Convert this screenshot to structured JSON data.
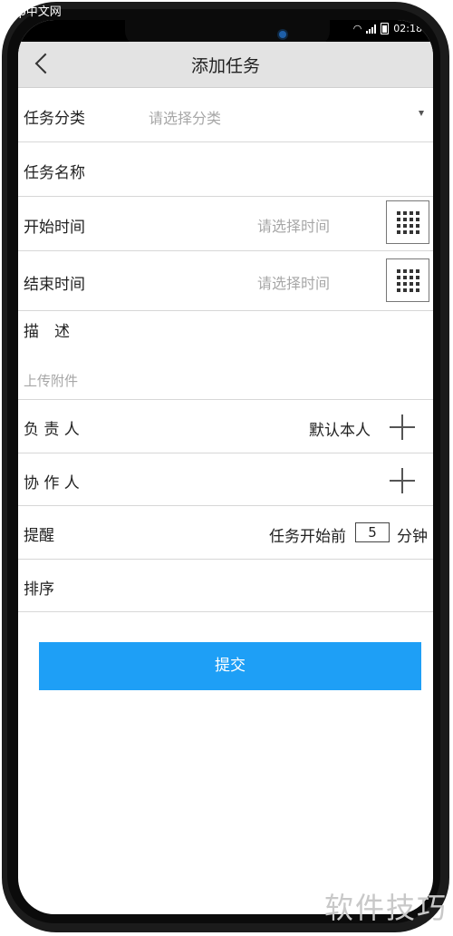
{
  "watermark_top": "php中文网",
  "watermark_bottom": "软件技巧",
  "status": {
    "time": "02:18"
  },
  "header": {
    "title": "添加任务",
    "back_icon": "chevron-left-icon"
  },
  "form": {
    "category": {
      "label": "任务分类",
      "placeholder": "请选择分类"
    },
    "name": {
      "label": "任务名称"
    },
    "start": {
      "label": "开始时间",
      "placeholder": "请选择时间",
      "icon": "calendar-grid-icon"
    },
    "end": {
      "label": "结束时间",
      "placeholder": "请选择时间",
      "icon": "calendar-grid-icon"
    },
    "description": {
      "label": "描　述"
    },
    "attachment": {
      "label": "上传附件"
    },
    "owner": {
      "label": "负 责 人",
      "value": "默认本人",
      "icon": "plus-icon"
    },
    "collaborator": {
      "label": "协 作 人",
      "icon": "plus-icon"
    },
    "reminder": {
      "label": "提醒",
      "prefix": "任务开始前",
      "value": "5",
      "suffix": "分钟"
    },
    "sort": {
      "label": "排序"
    }
  },
  "submit": {
    "label": "提交"
  },
  "colors": {
    "accent": "#1e9ff6",
    "header_bg": "#e3e3e3"
  }
}
